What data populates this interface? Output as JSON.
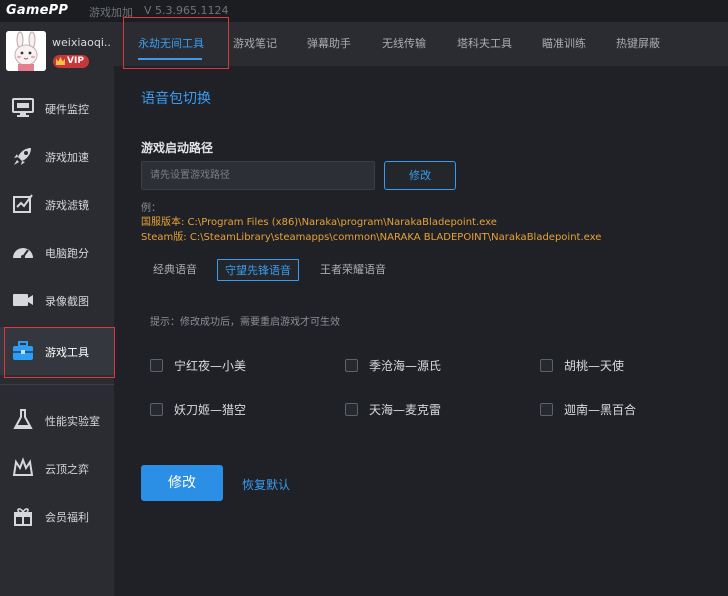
{
  "app": {
    "logo": "GamePP",
    "subtitle": "游戏加加",
    "version": "V 5.3.965.1124"
  },
  "user": {
    "name": "weixiaoqi...",
    "badge": "VIP"
  },
  "sidebar": {
    "items": [
      {
        "label": "硬件监控",
        "icon": "monitor-icon"
      },
      {
        "label": "游戏加速",
        "icon": "rocket-icon"
      },
      {
        "label": "游戏滤镜",
        "icon": "filter-icon"
      },
      {
        "label": "电脑跑分",
        "icon": "speedometer-icon"
      },
      {
        "label": "录像截图",
        "icon": "camera-icon"
      },
      {
        "label": "游戏工具",
        "icon": "toolbox-icon",
        "active": true
      },
      {
        "label": "性能实验室",
        "icon": "flask-icon"
      },
      {
        "label": "云顶之弈",
        "icon": "crown-icon"
      },
      {
        "label": "会员福利",
        "icon": "gift-icon"
      }
    ]
  },
  "tabs": [
    {
      "label": "永劫无间工具",
      "active": true
    },
    {
      "label": "游戏笔记"
    },
    {
      "label": "弹幕助手"
    },
    {
      "label": "无线传输"
    },
    {
      "label": "塔科夫工具"
    },
    {
      "label": "瞄准训练"
    },
    {
      "label": "热键屏蔽"
    }
  ],
  "main": {
    "section_title": "语音包切换",
    "path_label": "游戏启动路径",
    "path_value": "",
    "path_placeholder": "请先设置游戏路径",
    "modify_small": "修改",
    "example_label": "例：",
    "example_cn": "国服版本: C:\\Program Files (x86)\\Naraka\\program\\NarakaBladepoint.exe",
    "example_steam": "Steam版: C:\\SteamLibrary\\steamapps\\common\\NARAKA BLADEPOINT\\NarakaBladepoint.exe",
    "voice_tabs": [
      {
        "label": "经典语音"
      },
      {
        "label": "守望先锋语音",
        "selected": true
      },
      {
        "label": "王者荣耀语音"
      }
    ],
    "hint": "提示：修改成功后，需要重启游戏才可生效",
    "options": [
      "宁红夜—小美",
      "季沧海—源氏",
      "胡桃—天使",
      "妖刀姬—猎空",
      "天海—麦克雷",
      "迦南—黑百合"
    ],
    "apply_button": "修改",
    "reset_link": "恢复默认"
  },
  "colors": {
    "accent": "#3a9cf0",
    "warning_text": "#e8a237",
    "highlight_box": "#d9383f",
    "vip": "#c8353a"
  }
}
